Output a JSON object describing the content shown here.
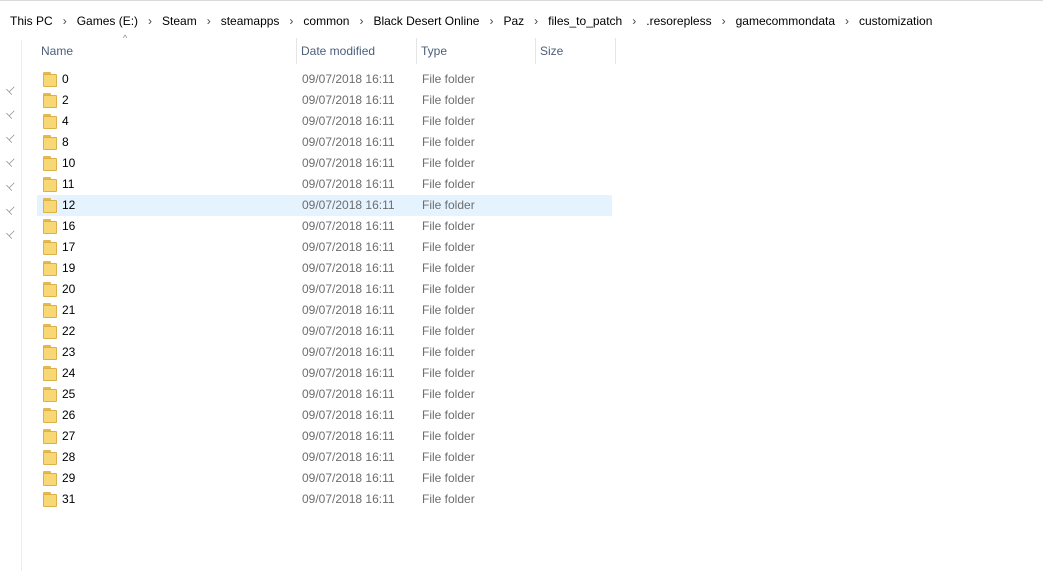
{
  "breadcrumb": {
    "items": [
      "This PC",
      "Games (E:)",
      "Steam",
      "steamapps",
      "common",
      "Black Desert Online",
      "Paz",
      "files_to_patch",
      ".resorepless",
      "gamecommondata",
      "customization"
    ],
    "separator": "›"
  },
  "columns": {
    "name": "Name",
    "date_modified": "Date modified",
    "type": "Type",
    "size": "Size"
  },
  "sort": {
    "column": "name",
    "icon": "sort-up-caret"
  },
  "pins": {
    "icon": "pin-icon",
    "count": 7
  },
  "selected_index": 6,
  "colors": {
    "selected_row": "#e5f3ff",
    "folder": "#f8d775",
    "header_text": "#4c607a"
  },
  "files": [
    {
      "name": "0",
      "date": "09/07/2018 16:11",
      "type": "File folder"
    },
    {
      "name": "2",
      "date": "09/07/2018 16:11",
      "type": "File folder"
    },
    {
      "name": "4",
      "date": "09/07/2018 16:11",
      "type": "File folder"
    },
    {
      "name": "8",
      "date": "09/07/2018 16:11",
      "type": "File folder"
    },
    {
      "name": "10",
      "date": "09/07/2018 16:11",
      "type": "File folder"
    },
    {
      "name": "11",
      "date": "09/07/2018 16:11",
      "type": "File folder"
    },
    {
      "name": "12",
      "date": "09/07/2018 16:11",
      "type": "File folder"
    },
    {
      "name": "16",
      "date": "09/07/2018 16:11",
      "type": "File folder"
    },
    {
      "name": "17",
      "date": "09/07/2018 16:11",
      "type": "File folder"
    },
    {
      "name": "19",
      "date": "09/07/2018 16:11",
      "type": "File folder"
    },
    {
      "name": "20",
      "date": "09/07/2018 16:11",
      "type": "File folder"
    },
    {
      "name": "21",
      "date": "09/07/2018 16:11",
      "type": "File folder"
    },
    {
      "name": "22",
      "date": "09/07/2018 16:11",
      "type": "File folder"
    },
    {
      "name": "23",
      "date": "09/07/2018 16:11",
      "type": "File folder"
    },
    {
      "name": "24",
      "date": "09/07/2018 16:11",
      "type": "File folder"
    },
    {
      "name": "25",
      "date": "09/07/2018 16:11",
      "type": "File folder"
    },
    {
      "name": "26",
      "date": "09/07/2018 16:11",
      "type": "File folder"
    },
    {
      "name": "27",
      "date": "09/07/2018 16:11",
      "type": "File folder"
    },
    {
      "name": "28",
      "date": "09/07/2018 16:11",
      "type": "File folder"
    },
    {
      "name": "29",
      "date": "09/07/2018 16:11",
      "type": "File folder"
    },
    {
      "name": "31",
      "date": "09/07/2018 16:11",
      "type": "File folder"
    }
  ]
}
